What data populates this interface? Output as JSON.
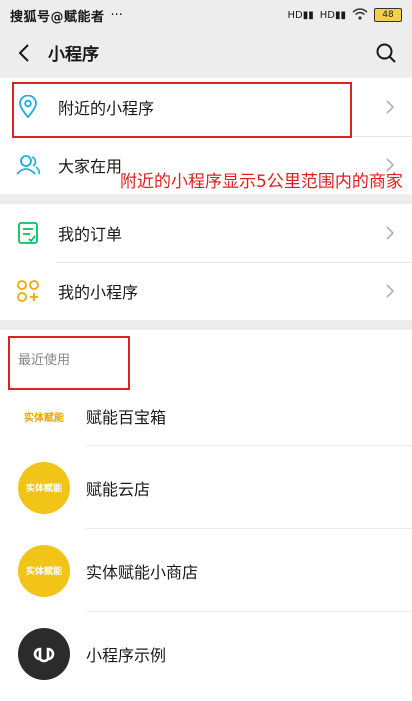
{
  "status": {
    "carrier": "搜狐号@赋能者",
    "right_icons": [
      "hd-signal-icon",
      "hd-signal-icon",
      "wifi-icon"
    ],
    "battery": "48"
  },
  "nav": {
    "title": "小程序"
  },
  "menu1": [
    {
      "label": "附近的小程序",
      "icon": "location-pin-icon"
    },
    {
      "label": "大家在用",
      "icon": "people-icon"
    }
  ],
  "menu2": [
    {
      "label": "我的订单",
      "icon": "order-list-icon"
    },
    {
      "label": "我的小程序",
      "icon": "mini-program-grid-icon"
    }
  ],
  "recent": {
    "header": "最近使用",
    "apps": [
      {
        "name": "赋能百宝箱",
        "logo_text": "实体赋能"
      },
      {
        "name": "赋能云店",
        "logo_text": "实体赋能"
      },
      {
        "name": "实体赋能小商店",
        "logo_text": "实体赋能"
      },
      {
        "name": "小程序示例",
        "logo_text": ""
      }
    ]
  },
  "annotation": {
    "text": "附近的小程序显示5公里范围内的商家",
    "color": "#e02020"
  },
  "colors": {
    "accent_green": "#07c160",
    "blue": "#1aaddc",
    "annotation_red": "#e02020",
    "logo_yellow": "#f2c417"
  }
}
